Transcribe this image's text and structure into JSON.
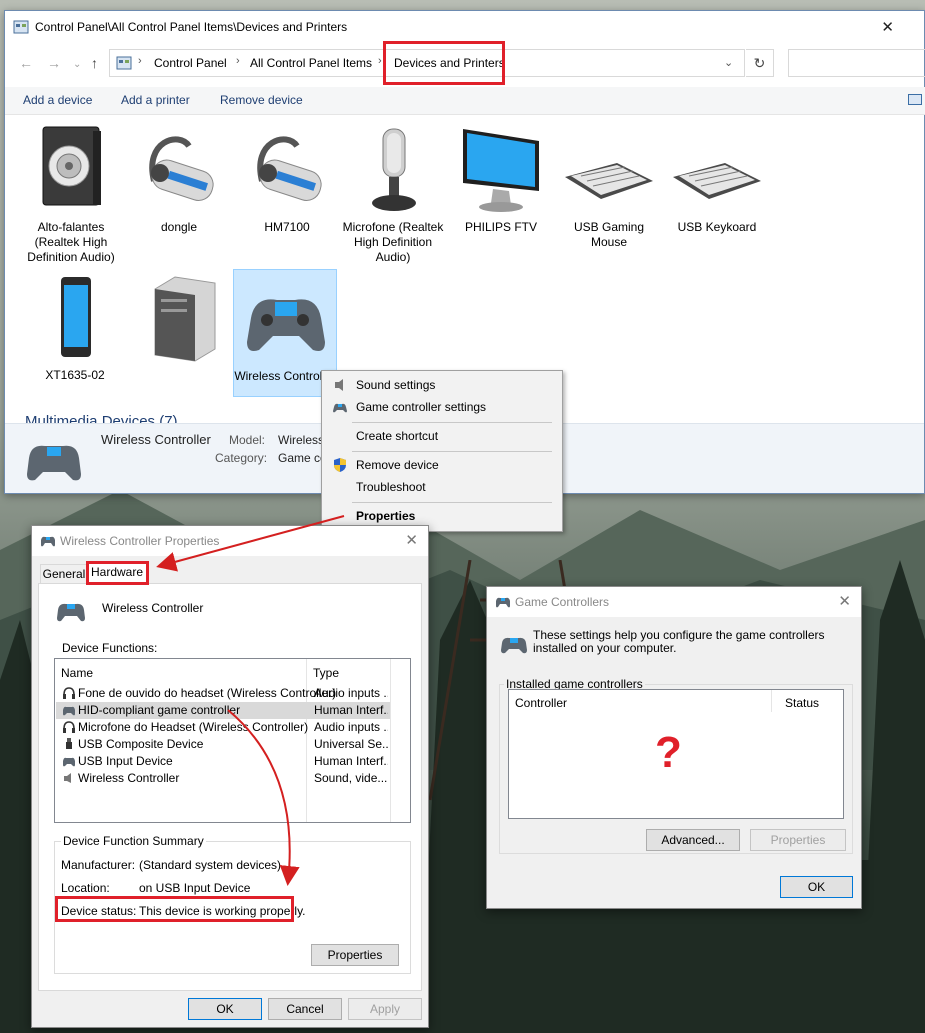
{
  "explorer": {
    "title": "Control Panel\\All Control Panel Items\\Devices and Printers",
    "breadcrumb": [
      "Control Panel",
      "All Control Panel Items",
      "Devices and Printers"
    ],
    "commands": [
      "Add a device",
      "Add a printer",
      "Remove device"
    ],
    "devices": [
      {
        "label": "Alto-falantes (Realtek High Definition Audio)",
        "icon": "speaker-icon"
      },
      {
        "label": "dongle",
        "icon": "headset-icon"
      },
      {
        "label": "HM7100",
        "icon": "headset-icon"
      },
      {
        "label": "Microfone (Realtek High Definition Audio)",
        "icon": "microphone-icon"
      },
      {
        "label": "PHILIPS FTV",
        "icon": "monitor-icon"
      },
      {
        "label": "USB Gaming Mouse",
        "icon": "keyboard-icon"
      },
      {
        "label": "USB Keykoard",
        "icon": "keyboard-icon"
      },
      {
        "label": "XT1635-02",
        "icon": "phone-icon"
      },
      {
        "label": "",
        "icon": "computer-tower-icon"
      },
      {
        "label": "Wireless Controller",
        "icon": "gamepad-icon",
        "selected": true
      }
    ],
    "group_header": "Multimedia Devices (7)",
    "details": {
      "name": "Wireless Controller",
      "model_label": "Model:",
      "model_value": "Wireless",
      "category_label": "Category:",
      "category_value": "Game co"
    }
  },
  "context_menu": {
    "items": [
      "Sound settings",
      "Game controller settings",
      "Create shortcut",
      "Remove device",
      "Troubleshoot",
      "Properties"
    ]
  },
  "properties_dialog": {
    "title": "Wireless Controller Properties",
    "tabs": [
      "General",
      "Hardware"
    ],
    "device_name": "Wireless Controller",
    "functions_label": "Device Functions:",
    "columns": [
      "Name",
      "Type"
    ],
    "rows": [
      {
        "name": "Fone de ouvido do headset (Wireless Controller)",
        "type": "Audio inputs ...",
        "icon": "headphones-icon"
      },
      {
        "name": "HID-compliant game controller",
        "type": "Human Interf...",
        "icon": "gamepad-icon",
        "selected": true
      },
      {
        "name": "Microfone do Headset (Wireless Controller)",
        "type": "Audio inputs ...",
        "icon": "headphones-icon"
      },
      {
        "name": "USB Composite Device",
        "type": "Universal Se...",
        "icon": "usb-icon"
      },
      {
        "name": "USB Input Device",
        "type": "Human Interf...",
        "icon": "gamepad-icon"
      },
      {
        "name": "Wireless Controller",
        "type": "Sound, vide...",
        "icon": "speaker-icon"
      }
    ],
    "summary_label": "Device Function Summary",
    "manufacturer_label": "Manufacturer:",
    "manufacturer_value": "(Standard system devices)",
    "location_label": "Location:",
    "location_value": "on USB Input Device",
    "status_label": "Device status:",
    "status_value": "This device is working properly.",
    "properties_button": "Properties",
    "ok_button": "OK",
    "cancel_button": "Cancel",
    "apply_button": "Apply"
  },
  "game_controllers_dialog": {
    "title": "Game Controllers",
    "description": "These settings help you configure the game controllers installed on your computer.",
    "installed_label": "Installed game controllers",
    "columns": [
      "Controller",
      "Status"
    ],
    "mark": "?",
    "advanced_button": "Advanced...",
    "properties_button": "Properties",
    "ok_button": "OK"
  },
  "colors": {
    "highlight_red": "#e0202a",
    "selection_blue": "#cce8ff",
    "link_blue": "#1e3e72"
  }
}
